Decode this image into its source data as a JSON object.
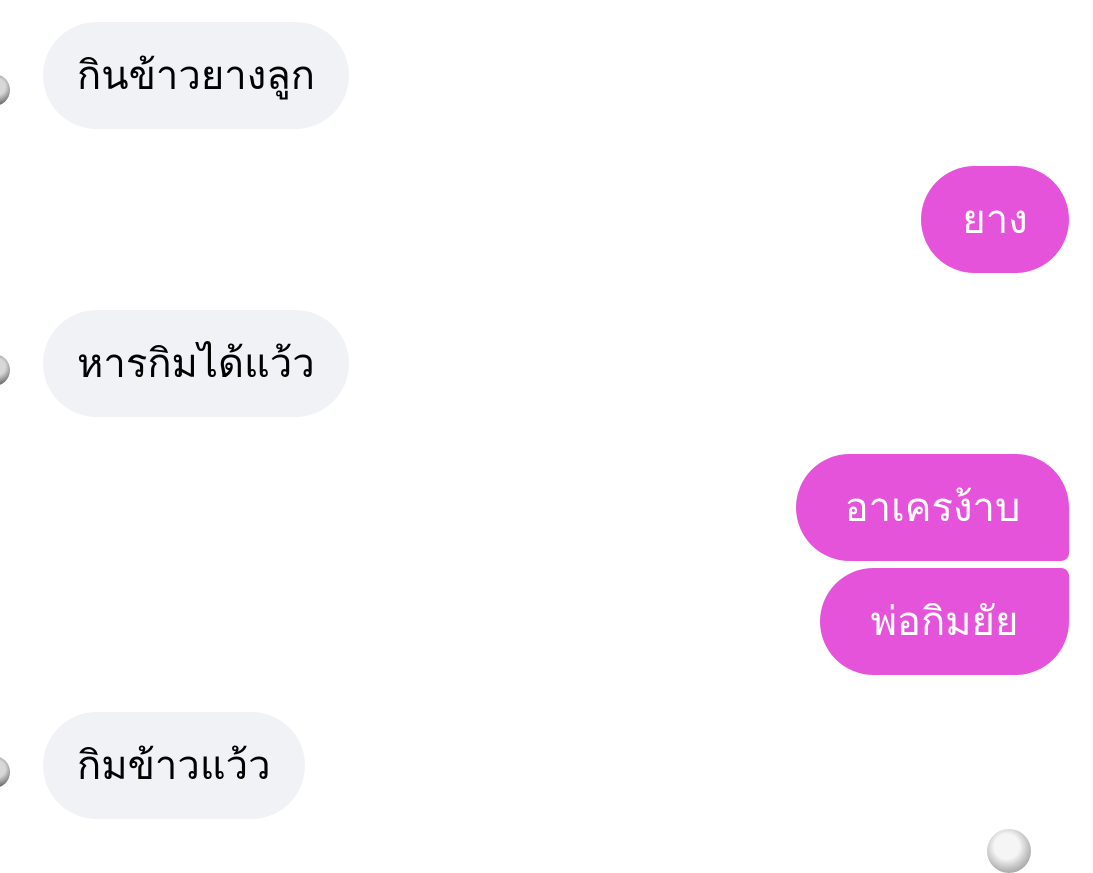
{
  "conversation": {
    "messages": [
      {
        "sender": "other",
        "text": "กินข้าวยางลูก"
      },
      {
        "sender": "me",
        "text": "ยาง"
      },
      {
        "sender": "other",
        "text": "หารกิมได้แว้ว"
      },
      {
        "sender": "me",
        "text": "อาเครง้าบ"
      },
      {
        "sender": "me",
        "text": "พ่อกิมยัย"
      },
      {
        "sender": "other",
        "text": "กิมข้าวแว้ว"
      }
    ]
  },
  "colors": {
    "incoming_bubble": "#f1f2f6",
    "outgoing_bubble": "#e553da",
    "incoming_text": "#000000",
    "outgoing_text": "#ffffff"
  }
}
